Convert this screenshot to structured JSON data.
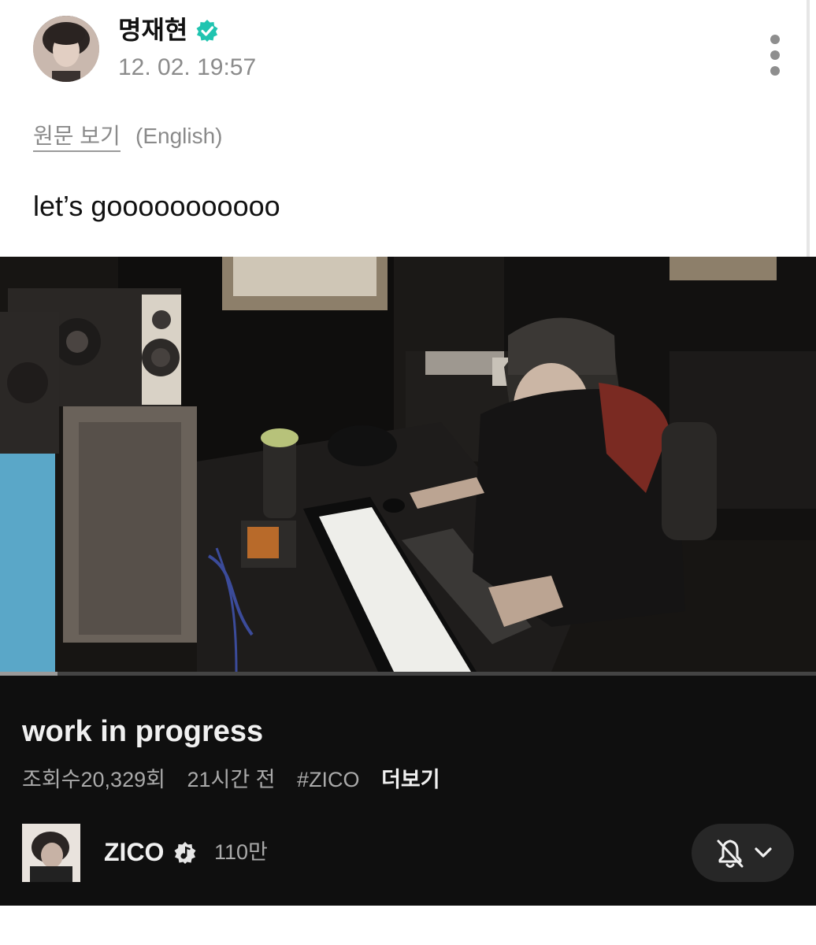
{
  "post": {
    "author_name": "명재현",
    "timestamp": "12. 02. 19:57",
    "view_original": "원문 보기",
    "original_language": "(English)",
    "text": "let’s gooooooooooo"
  },
  "icons": {
    "verified": "verified-badge-icon",
    "more": "more-vertical-icon",
    "music_channel": "music-note-badge-icon",
    "notifications_off": "bell-off-icon",
    "chevron": "chevron-down-icon"
  },
  "colors": {
    "verified_accent": "#20c4b0",
    "video_background": "#0f0f0f",
    "link_gray": "#8a8a8a"
  },
  "video": {
    "title": "work in progress",
    "views": "조회수20,329회",
    "age": "21시간 전",
    "hashtag": "#ZICO",
    "more_label": "더보기",
    "progress": 0.07,
    "channel": {
      "name": "ZICO",
      "subscribers": "110만"
    }
  }
}
